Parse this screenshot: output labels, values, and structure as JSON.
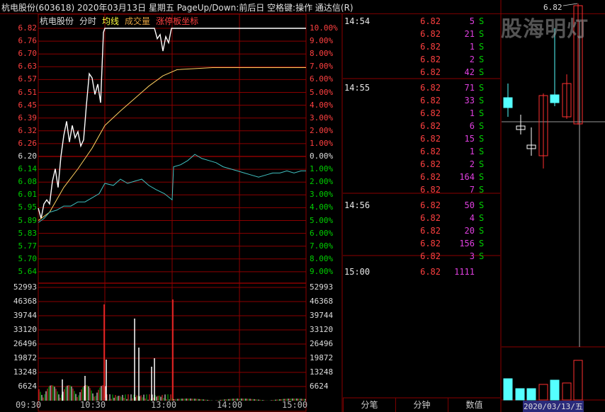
{
  "header": {
    "title": "杭电股份(603618)  2020年03月13日 星期五 PageUp/Down:前后日 空格键:操作 通达信(R)"
  },
  "legend": {
    "name": "杭电股份",
    "mode": "分时",
    "avg": "均线",
    "volume": "成交量",
    "limit": "涨停板坐标"
  },
  "price_axis": {
    "left": [
      "6.82",
      "6.76",
      "6.70",
      "6.63",
      "6.57",
      "6.51",
      "6.45",
      "6.39",
      "6.32",
      "6.26",
      "6.20",
      "6.14",
      "6.08",
      "6.01",
      "5.95",
      "5.89",
      "5.83",
      "5.77",
      "5.70",
      "5.64"
    ],
    "right": [
      "10.00%",
      "9.00%",
      "8.00%",
      "7.00%",
      "6.00%",
      "5.00%",
      "4.00%",
      "3.00%",
      "2.00%",
      "1.00%",
      "0.00%",
      "1.00%",
      "2.00%",
      "3.00%",
      "4.00%",
      "5.00%",
      "6.00%",
      "7.00%",
      "8.00%",
      "9.00%"
    ]
  },
  "volume_axis": [
    "52993",
    "46368",
    "39744",
    "33120",
    "26496",
    "19872",
    "13248",
    "6624"
  ],
  "time_axis": [
    "09:30",
    "10:30",
    "13:00",
    "14:00",
    "15:00"
  ],
  "ticks": [
    {
      "time": "14:54",
      "price": "6.82",
      "vol": "5",
      "type": "S"
    },
    {
      "time": "",
      "price": "6.82",
      "vol": "21",
      "type": "S"
    },
    {
      "time": "",
      "price": "6.82",
      "vol": "1",
      "type": "S"
    },
    {
      "time": "",
      "price": "6.82",
      "vol": "2",
      "type": "S"
    },
    {
      "time": "",
      "price": "6.82",
      "vol": "42",
      "type": "S"
    },
    {
      "time": "14:55",
      "price": "6.82",
      "vol": "71",
      "type": "S"
    },
    {
      "time": "",
      "price": "6.82",
      "vol": "33",
      "type": "S"
    },
    {
      "time": "",
      "price": "6.82",
      "vol": "1",
      "type": "S"
    },
    {
      "time": "",
      "price": "6.82",
      "vol": "6",
      "type": "S"
    },
    {
      "time": "",
      "price": "6.82",
      "vol": "15",
      "type": "S"
    },
    {
      "time": "",
      "price": "6.82",
      "vol": "1",
      "type": "S"
    },
    {
      "time": "",
      "price": "6.82",
      "vol": "2",
      "type": "S"
    },
    {
      "time": "",
      "price": "6.82",
      "vol": "164",
      "type": "S"
    },
    {
      "time": "",
      "price": "6.82",
      "vol": "7",
      "type": "S"
    },
    {
      "time": "14:56",
      "price": "6.82",
      "vol": "50",
      "type": "S"
    },
    {
      "time": "",
      "price": "6.82",
      "vol": "4",
      "type": "S"
    },
    {
      "time": "",
      "price": "6.82",
      "vol": "20",
      "type": "S"
    },
    {
      "time": "",
      "price": "6.82",
      "vol": "156",
      "type": "S"
    },
    {
      "time": "",
      "price": "6.82",
      "vol": "3",
      "type": "S"
    },
    {
      "time": "15:00",
      "price": "6.82",
      "vol": "1111",
      "type": ""
    }
  ],
  "tabs": [
    "分笔",
    "分钟",
    "数值"
  ],
  "kline": {
    "watermark": "股海明灯",
    "top_price": "6.82",
    "date": "2020/03/13/五"
  },
  "colors": {
    "grid": "#8b0000",
    "up": "#ff3030",
    "down": "#00c000",
    "price_line": "#ffffff",
    "avg_line": "#ffd060",
    "after_line": "#40c0c0",
    "cyan": "#55ffff"
  }
}
